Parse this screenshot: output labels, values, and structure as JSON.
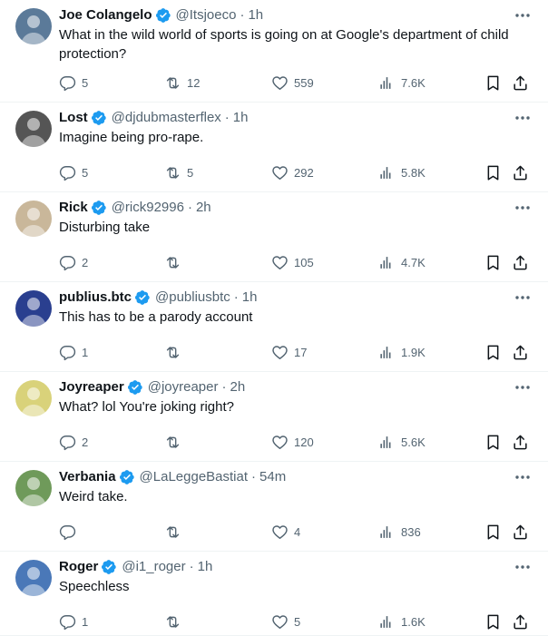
{
  "tweets": [
    {
      "name": "Joe Colangelo",
      "handle": "@Itsjoeco",
      "time": "1h",
      "text": "What in the wild world of sports is going on at Google's department of child protection?",
      "replies": "5",
      "retweets": "12",
      "likes": "559",
      "views": "7.6K",
      "avatar_color": "#5b7a99"
    },
    {
      "name": "Lost",
      "handle": "@djdubmasterflex",
      "time": "1h",
      "text": "Imagine being pro-rape.",
      "replies": "5",
      "retweets": "5",
      "likes": "292",
      "views": "5.8K",
      "avatar_color": "#555555"
    },
    {
      "name": "Rick",
      "handle": "@rick92996",
      "time": "2h",
      "text": "Disturbing take",
      "replies": "2",
      "retweets": "",
      "likes": "105",
      "views": "4.7K",
      "avatar_color": "#c9b79a"
    },
    {
      "name": "publius.btc",
      "handle": "@publiusbtc",
      "time": "1h",
      "text": "This has to be a parody account",
      "replies": "1",
      "retweets": "",
      "likes": "17",
      "views": "1.9K",
      "avatar_color": "#2a3f8f"
    },
    {
      "name": "Joyreaper",
      "handle": "@joyreaper",
      "time": "2h",
      "text": "What? lol You're joking right?",
      "replies": "2",
      "retweets": "",
      "likes": "120",
      "views": "5.6K",
      "avatar_color": "#d9d27a"
    },
    {
      "name": "Verbania",
      "handle": "@LaLeggeBastiat",
      "time": "54m",
      "text": "Weird take.",
      "replies": "",
      "retweets": "",
      "likes": "4",
      "views": "836",
      "avatar_color": "#6f9a5a"
    },
    {
      "name": "Roger",
      "handle": "@i1_roger",
      "time": "1h",
      "text": "Speechless",
      "replies": "1",
      "retweets": "",
      "likes": "5",
      "views": "1.6K",
      "avatar_color": "#4a78b8"
    }
  ],
  "separator": "·",
  "colors": {
    "text_primary": "#0f1419",
    "text_secondary": "#536471",
    "verified_badge": "#1d9bf0",
    "divider": "#eff3f4"
  },
  "icons": {
    "verified": "verified-badge-icon",
    "more": "more-dots-icon",
    "reply": "reply-icon",
    "retweet": "retweet-icon",
    "like": "heart-icon",
    "views": "views-chart-icon",
    "bookmark": "bookmark-icon",
    "share": "share-icon"
  }
}
